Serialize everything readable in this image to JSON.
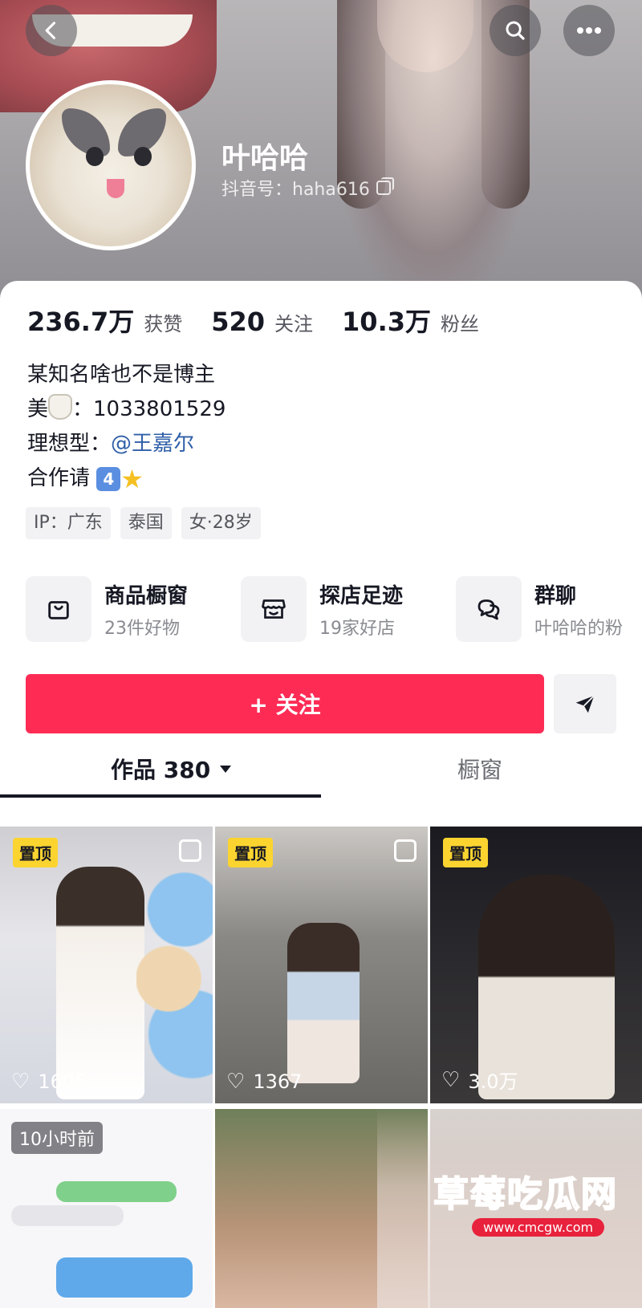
{
  "header": {
    "nickname": "叶哈哈",
    "douyin_id": "抖音号：haha616"
  },
  "stats": [
    {
      "value": "236.7万",
      "label": "获赞"
    },
    {
      "value": "520",
      "label": "关注"
    },
    {
      "value": "10.3万",
      "label": "粉丝"
    }
  ],
  "bio": {
    "line1": "某知名啥也不是博主",
    "line2_prefix": "美",
    "line2_value": "：1033801529",
    "line3_prefix": "理想型：",
    "line3_mention": "@王嘉尔",
    "line4_prefix": "合作请",
    "line4_badge": "4"
  },
  "tags": [
    "IP：广东",
    "泰国",
    "女·28岁"
  ],
  "services": [
    {
      "title": "商品橱窗",
      "sub": "23件好物",
      "icon": "bag-icon"
    },
    {
      "title": "探店足迹",
      "sub": "19家好店",
      "icon": "shop-icon"
    },
    {
      "title": "群聊",
      "sub": "叶哈哈的粉",
      "icon": "chat-icon"
    }
  ],
  "follow_label": "+ 关注",
  "tabs": {
    "works": "作品 380",
    "window": "橱窗"
  },
  "grid": [
    {
      "pin": "置顶",
      "likes": "1605"
    },
    {
      "pin": "置顶",
      "likes": "1367"
    },
    {
      "pin": "置顶",
      "likes": "3.0万"
    },
    {
      "time": "10小时前"
    },
    {},
    {}
  ],
  "watermark": {
    "text": "草莓吃瓜网",
    "url": "www.cmcgw.com"
  },
  "colors": {
    "accent": "#fe2c55",
    "mention": "#2f5fa8",
    "pin": "#fbd430"
  }
}
